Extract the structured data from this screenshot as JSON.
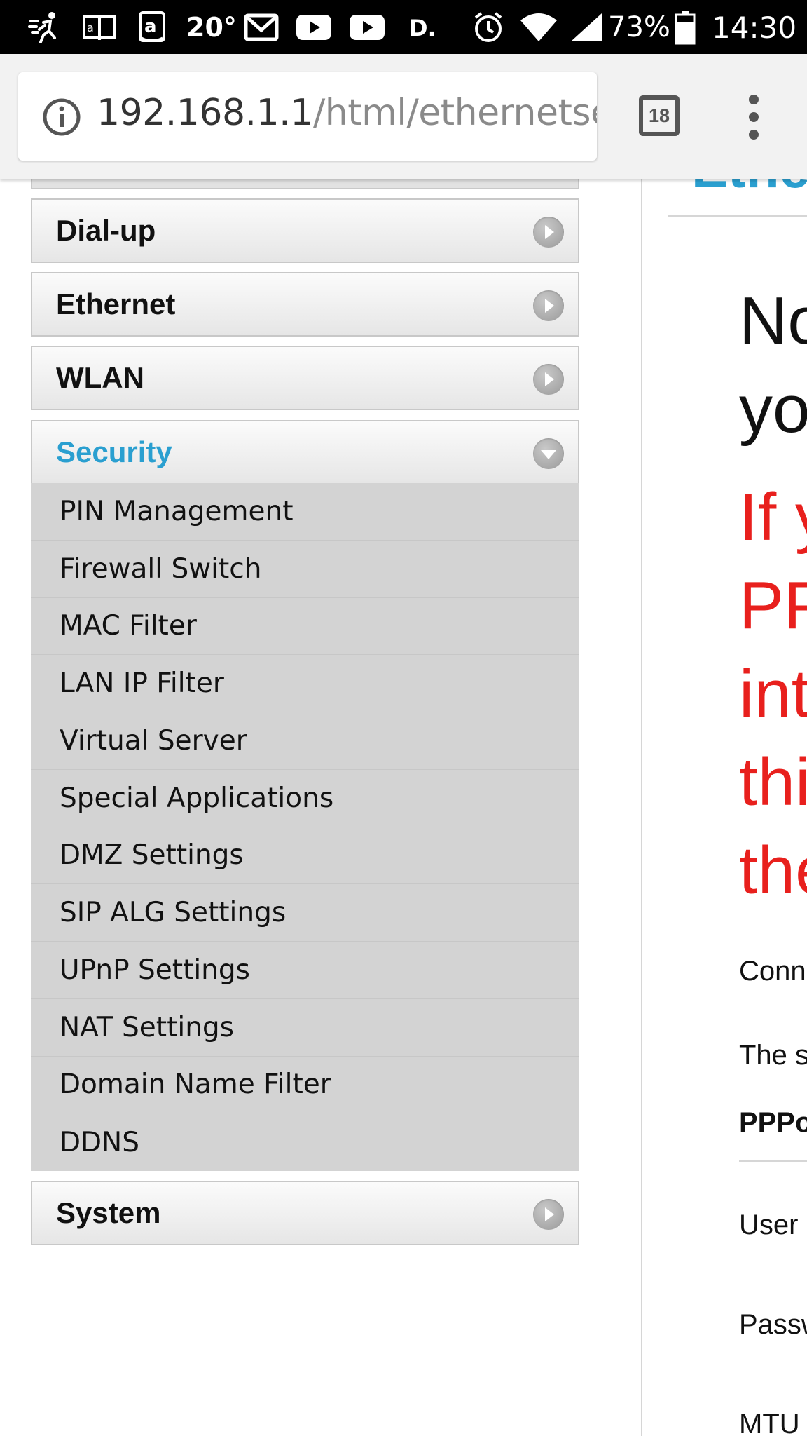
{
  "status_bar": {
    "temperature": "20°",
    "battery": "73%",
    "time": "14:30"
  },
  "browser": {
    "url_host": "192.168.1.1",
    "url_path": "/html/ethernetsett",
    "tab_count": "18"
  },
  "sidebar": {
    "items": [
      {
        "label": "Dial-up"
      },
      {
        "label": "Ethernet"
      },
      {
        "label": "WLAN"
      },
      {
        "label": "Security"
      },
      {
        "label": "System"
      }
    ],
    "security_sub": [
      "PIN Management",
      "Firewall Switch",
      "MAC Filter",
      "LAN IP Filter",
      "Virtual Server",
      "Special Applications",
      "DMZ Settings",
      "SIP ALG Settings",
      "UPnP Settings",
      "NAT Settings",
      "Domain Name Filter",
      "DDNS"
    ]
  },
  "content": {
    "title_partial": "Ethe",
    "notice_lines": [
      "No",
      "yo"
    ],
    "warning_lines": [
      "If y",
      "PP",
      "int",
      "thi",
      "the"
    ],
    "fields": {
      "connection": "Conne",
      "the_s": "The s",
      "pppoe": "PPPo",
      "user": "User r",
      "password": "Passw",
      "mtu": "MTU"
    }
  },
  "colors": {
    "accent": "#2a9fd0",
    "warning": "#e8201d",
    "submenu_bg": "#d3d3d3"
  }
}
